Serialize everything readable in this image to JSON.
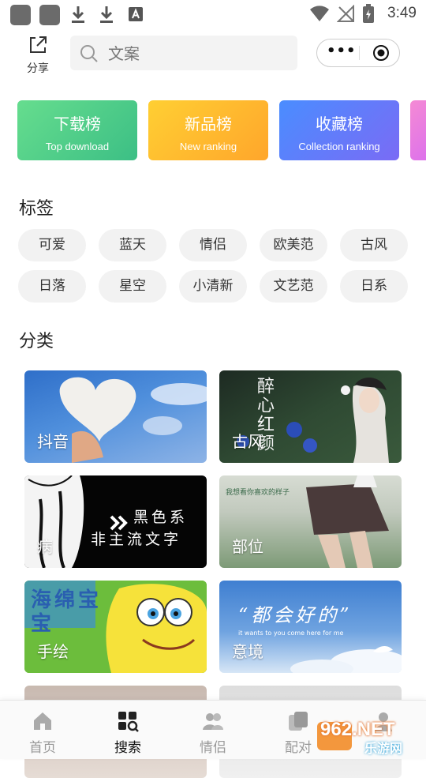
{
  "status_bar": {
    "time": "3:49"
  },
  "header": {
    "share_label": "分享",
    "search_placeholder": "文案",
    "capsule_more": "•••"
  },
  "rank_cards": [
    {
      "title": "下载榜",
      "subtitle": "Top download"
    },
    {
      "title": "新品榜",
      "subtitle": "New ranking"
    },
    {
      "title": "收藏榜",
      "subtitle": "Collection ranking"
    }
  ],
  "tags_section": {
    "title": "标签",
    "tags": [
      "可爱",
      "蓝天",
      "情侣",
      "欧美范",
      "古风",
      "日落",
      "星空",
      "小清新",
      "文艺范",
      "日系"
    ]
  },
  "category_section": {
    "title": "分类",
    "items": [
      {
        "label": "抖音"
      },
      {
        "label": "古风"
      },
      {
        "label": "病"
      },
      {
        "label": "部位"
      },
      {
        "label": "手绘"
      },
      {
        "label": "意境"
      }
    ]
  },
  "image_text": {
    "guofeng_art": "醉心红颜",
    "black_line1": "黑色系",
    "black_line2": "非主流文字",
    "bunai_quote": "我想看你喜欢的样子",
    "sponge_text": "海绵宝宝",
    "yijing_quote": "“都会好的”",
    "yijing_sub": "it wants to you come here for me"
  },
  "tabbar": {
    "tabs": [
      {
        "label": "首页"
      },
      {
        "label": "搜索"
      },
      {
        "label": "情侣"
      },
      {
        "label": "配对"
      }
    ]
  },
  "watermark": {
    "text1": "962.NET",
    "text2": "乐游网"
  },
  "colors": {
    "download_gradient": [
      "#5fd98a",
      "#3fbf86"
    ],
    "new_gradient": [
      "#ffcc33",
      "#ffa726"
    ],
    "collect_gradient": [
      "#4f8cff",
      "#7b6cf6"
    ],
    "fourth_gradient": [
      "#f28ad6",
      "#d96cf0"
    ]
  }
}
